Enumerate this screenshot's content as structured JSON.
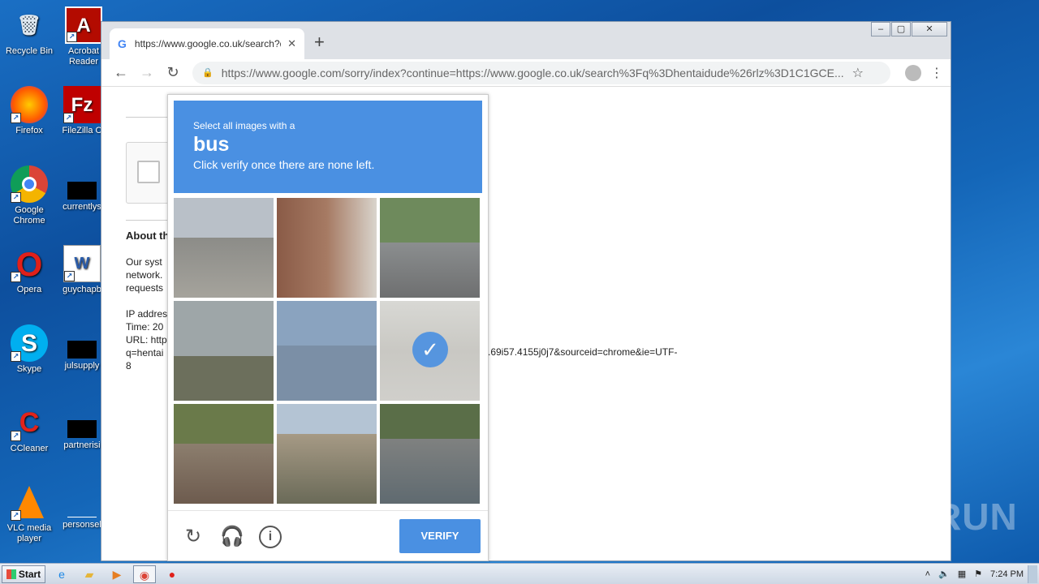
{
  "desktop": {
    "icons": [
      {
        "label": "Recycle Bin"
      },
      {
        "label": "Acrobat Reader"
      },
      {
        "label": "Firefox"
      },
      {
        "label": "FileZilla C"
      },
      {
        "label": "Google Chrome"
      },
      {
        "label": "currentlys"
      },
      {
        "label": "Opera"
      },
      {
        "label": "guychapb"
      },
      {
        "label": "Skype"
      },
      {
        "label": "julsupply"
      },
      {
        "label": "CCleaner"
      },
      {
        "label": "partnerisi"
      },
      {
        "label": "VLC media player"
      },
      {
        "label": "personsel"
      }
    ]
  },
  "browser": {
    "tab_title": "https://www.google.co.uk/search?q",
    "new_tab": "+",
    "address_url": "https://www.google.com/sorry/index?continue=https://www.google.co.uk/search%3Fq%3Dhentaidude%26rlz%3D1C1GCE..."
  },
  "page": {
    "about_heading": "About th",
    "para_lines": [
      "Our syst",
      "network.",
      "requests"
    ],
    "info_lines": [
      "IP addres",
      "Time: 20",
      "URL: http",
      "q=hentai",
      "8"
    ],
    "url_tail": ".69i57.4155j0j7&sourceid=chrome&ie=UTF-"
  },
  "captcha": {
    "instruction_line1": "Select all images with a",
    "target_word": "bus",
    "instruction_line3": "Click verify once there are none left.",
    "verify_label": "VERIFY",
    "tiles": [
      {
        "name": "road-overpass",
        "selected": false
      },
      {
        "name": "brick-houses",
        "selected": false
      },
      {
        "name": "traffic-light-street",
        "selected": false
      },
      {
        "name": "palm-tree-road",
        "selected": false
      },
      {
        "name": "highway-fog",
        "selected": false
      },
      {
        "name": "road-with-bus",
        "selected": true
      },
      {
        "name": "bus-on-street",
        "selected": false
      },
      {
        "name": "overpass-bridge",
        "selected": false
      },
      {
        "name": "cars-on-road",
        "selected": false
      }
    ],
    "colors": {
      "accent": "#4a90e2"
    }
  },
  "taskbar": {
    "start_label": "Start",
    "clock": "7:24 PM"
  },
  "watermark": "ANY RUN"
}
